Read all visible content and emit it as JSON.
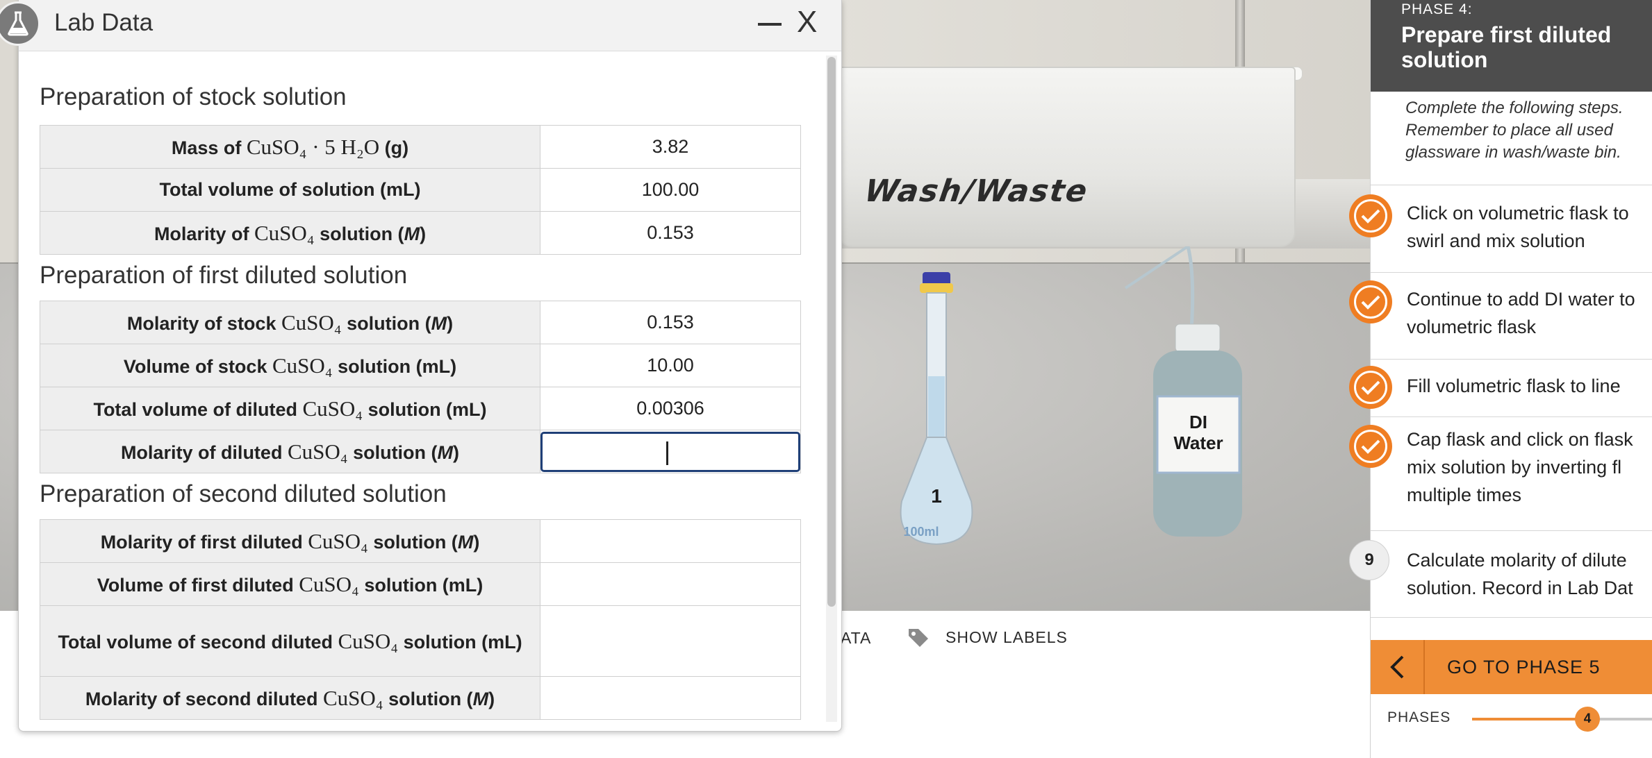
{
  "dialog": {
    "title": "Lab Data",
    "minimize_icon": "minimize-icon",
    "close_label": "X",
    "badge_icon": "flask-icon"
  },
  "scene": {
    "bin_label": "Wash/Waste",
    "flask_number": "1",
    "flask_volume": "100ml",
    "bottle_label_line1": "DI",
    "bottle_label_line2": "Water",
    "show_data_partial": "ATA",
    "show_labels": "SHOW LABELS",
    "tag_icon": "tag-icon"
  },
  "stock": {
    "heading": "Preparation of stock solution",
    "rows": [
      {
        "pre": "Mass of ",
        "chem": "CuSO₄ · 5 H₂O",
        "post": " (g)",
        "value": "3.82"
      },
      {
        "pre": "Total volume of solution (mL)",
        "chem": "",
        "post": "",
        "value": "100.00"
      },
      {
        "pre": "Molarity of ",
        "chem": "CuSO₄",
        "post": " solution (",
        "unit": "M",
        "close": ")",
        "value": "0.153"
      }
    ]
  },
  "first": {
    "heading": "Preparation of first diluted solution",
    "rows": [
      {
        "pre": "Molarity of stock ",
        "chem": "CuSO₄",
        "post": " solution (",
        "unit": "M",
        "close": ")",
        "value": "0.153"
      },
      {
        "pre": "Volume of stock ",
        "chem": "CuSO₄",
        "post": " solution (mL)",
        "value": "10.00"
      },
      {
        "pre": "Total volume of diluted ",
        "chem": "CuSO₄",
        "post": " solution (mL)",
        "value": "0.00306"
      },
      {
        "pre": "Molarity of diluted ",
        "chem": "CuSO₄",
        "post": " solution (",
        "unit": "M",
        "close": ")",
        "value": ""
      }
    ]
  },
  "second": {
    "heading": "Preparation of second diluted solution",
    "rows": [
      {
        "pre": "Molarity of first diluted ",
        "chem": "CuSO₄",
        "post": " solution (",
        "unit": "M",
        "close": ")",
        "value": ""
      },
      {
        "pre": "Volume of first diluted ",
        "chem": "CuSO₄",
        "post": " solution (mL)",
        "value": ""
      },
      {
        "pre": "Total volume of second diluted ",
        "chem": "CuSO₄",
        "post": " solution (mL)",
        "value": ""
      },
      {
        "pre": "Molarity of second diluted ",
        "chem": "CuSO₄",
        "post": " solution (",
        "unit": "M",
        "close": ")",
        "value": ""
      }
    ]
  },
  "panel": {
    "phase_number": "PHASE 4:",
    "phase_title": "Prepare first diluted solution",
    "instructions": "Complete the following steps. Remember to place all used glassware in wash/waste bin.",
    "steps": [
      {
        "line1": "Click on volumetric flask to",
        "line2": "swirl and mix solution",
        "status": "done"
      },
      {
        "line1": "Continue to add DI water to",
        "line2": "volumetric flask",
        "status": "done"
      },
      {
        "line1": "Fill volumetric flask to line",
        "line2": "",
        "status": "done"
      },
      {
        "line1": "Cap flask and click on flask",
        "line2": "mix solution by inverting fl",
        "line3": "multiple times",
        "status": "done"
      },
      {
        "line1": "Calculate molarity of dilute",
        "line2": "solution. Record in Lab Dat",
        "status": "current",
        "number": "9"
      }
    ],
    "check_icon": "checkmark-icon",
    "goto_label": "GO TO PHASE 5",
    "back_icon": "chevron-left-icon",
    "phases_label": "PHASES",
    "current_phase": "4"
  },
  "colors": {
    "accent": "#ef8d36",
    "header_dark": "#4d4d4d",
    "input_focus": "#1f3f77"
  }
}
